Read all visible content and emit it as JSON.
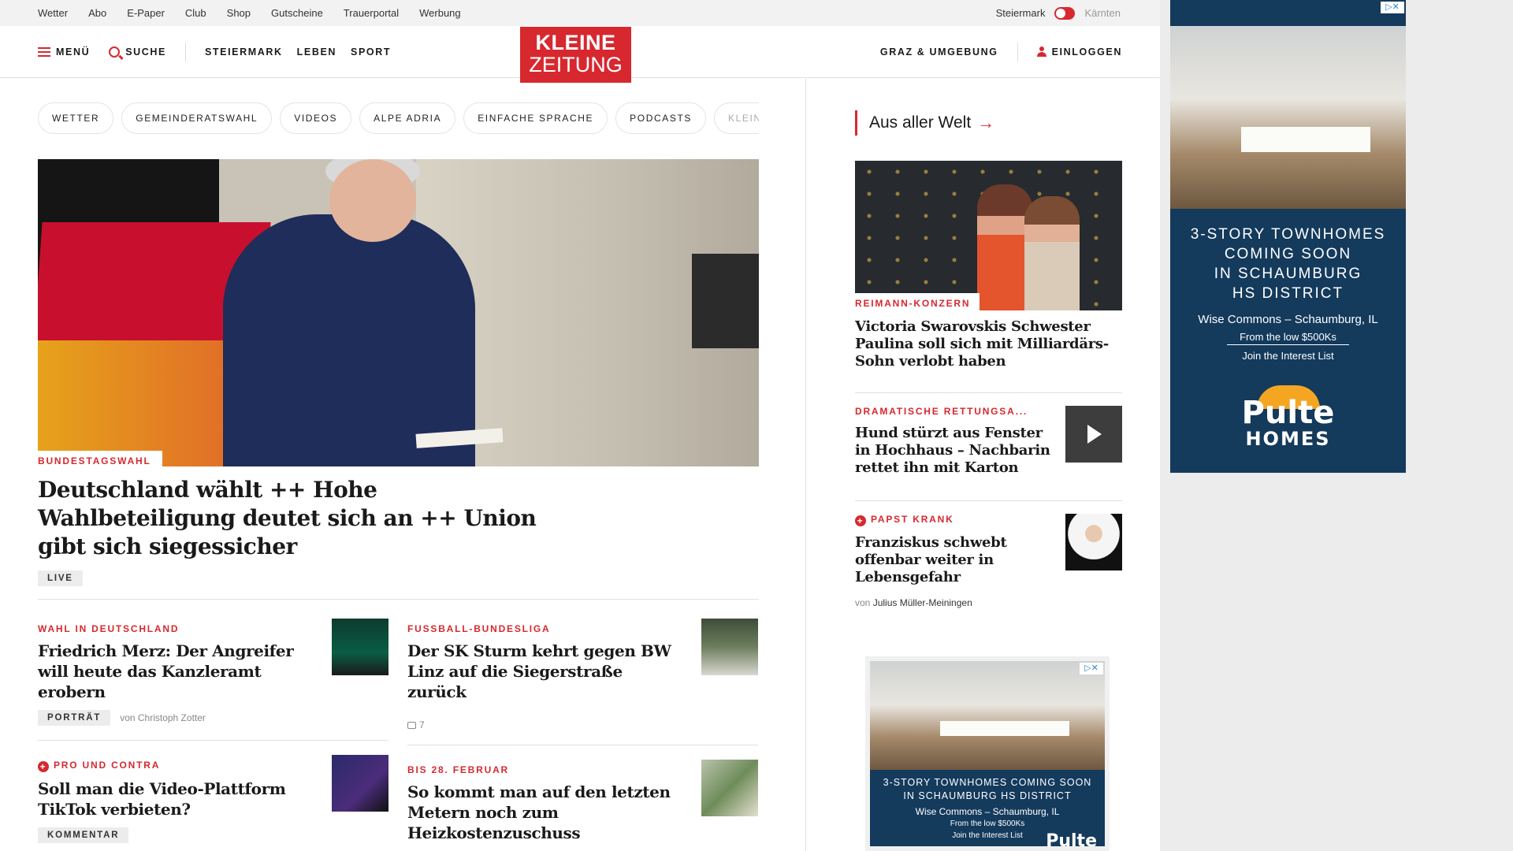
{
  "topbar": {
    "links": [
      "Wetter",
      "Abo",
      "E-Paper",
      "Club",
      "Shop",
      "Gutscheine",
      "Trauerportal",
      "Werbung"
    ],
    "region_active": "Steiermark",
    "region_inactive": "Kärnten"
  },
  "header": {
    "menu_label": "MENÜ",
    "search_label": "SUCHE",
    "nav": [
      "STEIERMARK",
      "LEBEN",
      "SPORT"
    ],
    "logo_line1": "KLEINE",
    "logo_line2": "ZEITUNG",
    "region_link": "GRAZ & UMGEBUNG",
    "login_label": "EINLOGGEN"
  },
  "chips": [
    "WETTER",
    "GEMEINDERATSWAHL",
    "VIDEOS",
    "ALPE ADRIA",
    "EINFACHE SPRACHE",
    "PODCASTS",
    "KLEINE"
  ],
  "chip_arrow": "›",
  "hero": {
    "kicker": "BUNDESTAGSWAHL",
    "title": "Deutschland wählt ++ Hohe Wahlbeteiligung deutet sich an ++ Union gibt sich siegessicher",
    "badge": "LIVE"
  },
  "articles_left": [
    {
      "kicker": "WAHL IN DEUTSCHLAND",
      "title": "Friedrich Merz: Der Angreifer will heute das Kanzleramt erobern",
      "badge": "PORTRÄT",
      "author": "von Christoph Zotter"
    },
    {
      "kicker": "PRO UND CONTRA",
      "title": "Soll man die Video-Plattform TikTok verbieten?",
      "badge": "KOMMENTAR"
    }
  ],
  "articles_right": [
    {
      "kicker": "FUSSBALL-BUNDESLIGA",
      "title": "Der SK Sturm kehrt gegen BW Linz auf die Siegerstraße zurück",
      "comments": "7"
    },
    {
      "kicker": "BIS 28. FEBRUAR",
      "title": "So kommt man auf den letzten Metern noch zum Heizkostenzuschuss"
    }
  ],
  "sidebar": {
    "section_title": "Aus aller Welt",
    "section_arrow": "→",
    "lead": {
      "kicker": "REIMANN-KONZERN",
      "title": "Victoria Swarovskis Schwester Paulina soll sich mit Milliardärs-Sohn verlobt haben"
    },
    "items": [
      {
        "kicker": "DRAMATISCHE RETTUNGSA...",
        "title": "Hund stürzt aus Fenster in Hochhaus – Nachbarin rettet ihn mit Karton"
      },
      {
        "kicker": "PAPST KRANK",
        "title": "Franziskus schwebt offenbar weiter in Lebensgefahr",
        "author_prefix": "von",
        "author": "Julius Müller-Meiningen"
      }
    ]
  },
  "ad": {
    "headline_1": "3-STORY TOWNHOMES",
    "headline_2": "COMING SOON",
    "headline_3": "IN SCHAUMBURG",
    "headline_4": "HS DISTRICT",
    "location": "Wise Commons – Schaumburg, IL",
    "price": "From the low $500Ks",
    "cta": "Join the Interest List",
    "brand_1": "Pulte",
    "brand_2": "HOMES",
    "small_headline": "3-STORY TOWNHOMES COMING SOON IN SCHAUMBURG HS DISTRICT",
    "small_location": "Wise Commons – Schaumburg, IL",
    "small_price": "From the low $500Ks",
    "small_cta": "Join the Interest List",
    "small_brand": "Pulte",
    "close": "▷✕"
  },
  "colors": {
    "accent": "#d7282f",
    "ad_blue": "#143a5c"
  }
}
